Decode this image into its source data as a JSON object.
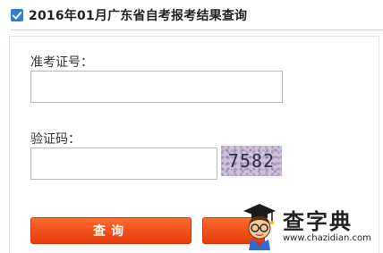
{
  "header": {
    "title": "2016年01月广东省自考报考结果查询"
  },
  "form": {
    "admission_label": "准考证号：",
    "admission_value": "",
    "captcha_label": "验证码：",
    "captcha_value": "",
    "captcha_text": "7582",
    "submit_label": "查询",
    "reset_label": ""
  },
  "watermark": {
    "brand": "查字典",
    "url": "www.chazidian.com"
  },
  "colors": {
    "accent_blue": "#2f7fd6",
    "button_orange": "#e94a12"
  }
}
